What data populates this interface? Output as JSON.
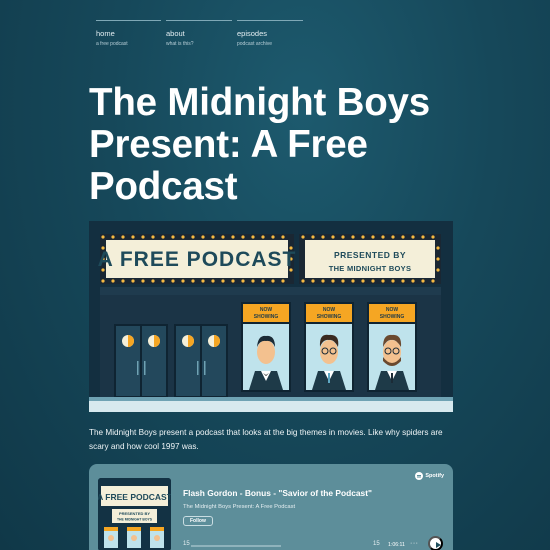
{
  "nav": {
    "items": [
      {
        "label": "home",
        "sub": "a free podcast"
      },
      {
        "label": "about",
        "sub": "what is this?"
      },
      {
        "label": "episodes",
        "sub": "podcast archive"
      }
    ]
  },
  "page_title": "The Midnight Boys Present: A Free Podcast",
  "hero": {
    "marquee_left": "A FREE PODCAST",
    "marquee_right_line1": "PRESENTED BY",
    "marquee_right_line2": "THE MIDNIGHT BOYS",
    "poster_label_line1": "NOW",
    "poster_label_line2": "SHOWING"
  },
  "description": "The Midnight Boys present a podcast that looks at the big themes in movies. Like why spiders are scary and how cool 1997 was.",
  "player": {
    "episode_title": "Flash Gordon - Bonus - \"Savior of the Podcast\"",
    "show_name": "The Midnight Boys Present: A Free Podcast",
    "follow_label": "Follow",
    "brand": "Spotify",
    "time": "1:06:11",
    "skip_back": "15",
    "skip_fwd": "15",
    "more": "···"
  },
  "colors": {
    "background": "#16485a",
    "player_bg": "#5d8e9a",
    "marquee": "#f4efd9",
    "poster_label": "#f5a623",
    "poster_bg": "#bfe3ec"
  }
}
